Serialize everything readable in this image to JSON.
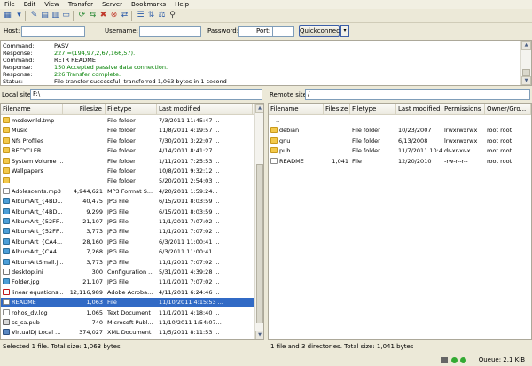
{
  "menu": [
    "File",
    "Edit",
    "View",
    "Transfer",
    "Server",
    "Bookmarks",
    "Help"
  ],
  "quickconnect": {
    "host_label": "Host:",
    "host_value": "",
    "username_label": "Username:",
    "username_value": "",
    "password_label": "Password:",
    "password_value": "",
    "port_label": "Port:",
    "port_value": "",
    "button_label": "Quickconnect",
    "dropdown_glyph": "▾"
  },
  "log": [
    {
      "key": "Command:",
      "text": "PASV",
      "color": "#000000"
    },
    {
      "key": "Response:",
      "text": "227 =(194,97,2,67,166,57).",
      "color": "#008000"
    },
    {
      "key": "Command:",
      "text": "RETR README",
      "color": "#000000"
    },
    {
      "key": "Response:",
      "text": "150 Accepted passive data connection.",
      "color": "#008000"
    },
    {
      "key": "Response:",
      "text": "226 Transfer complete.",
      "color": "#008000"
    },
    {
      "key": "Status:",
      "text": "File transfer successful, transferred 1,063 bytes in 1 second",
      "color": "#000000"
    }
  ],
  "local": {
    "site_label": "Local site:",
    "site_value": "F:\\",
    "columns": [
      "Filename",
      "Filesize",
      "Filetype",
      "Last modified"
    ],
    "rows": [
      {
        "icon": "folder",
        "name": "msdownld.tmp",
        "size": "",
        "type": "File folder",
        "modified": "7/3/2011 11:45:47 ..."
      },
      {
        "icon": "folder",
        "name": "Music",
        "size": "",
        "type": "File folder",
        "modified": "11/8/2011 4:19:57 ..."
      },
      {
        "icon": "folder",
        "name": "Nfs Profiles",
        "size": "",
        "type": "File folder",
        "modified": "7/30/2011 3:22:07 ..."
      },
      {
        "icon": "folder",
        "name": "RECYCLER",
        "size": "",
        "type": "File folder",
        "modified": "4/14/2011 8:41:27 ..."
      },
      {
        "icon": "folder",
        "name": "System Volume ...",
        "size": "",
        "type": "File folder",
        "modified": "1/11/2011 7:25:53 ..."
      },
      {
        "icon": "folder",
        "name": "Wallpapers",
        "size": "",
        "type": "File folder",
        "modified": "10/8/2011 9:32:12 ..."
      },
      {
        "icon": "folder",
        "name": "",
        "size": "",
        "type": "File folder",
        "modified": "5/20/2011 2:54:03 ..."
      },
      {
        "icon": "file",
        "name": "Adolescents.mp3",
        "size": "4,944,621",
        "type": "MP3 Format S...",
        "modified": "4/20/2011 1:59:24..."
      },
      {
        "icon": "img",
        "name": "AlbumArt_{4BD...",
        "size": "40,475",
        "type": "JPG File",
        "modified": "6/15/2011 8:03:59 ..."
      },
      {
        "icon": "img",
        "name": "AlbumArt_{4BD...",
        "size": "9,299",
        "type": "JPG File",
        "modified": "6/15/2011 8:03:59 ..."
      },
      {
        "icon": "img",
        "name": "AlbumArt_{52FF...",
        "size": "21,107",
        "type": "JPG File",
        "modified": "11/1/2011 7:07:02 ..."
      },
      {
        "icon": "img",
        "name": "AlbumArt_{52FF...",
        "size": "3,773",
        "type": "JPG File",
        "modified": "11/1/2011 7:07:02 ..."
      },
      {
        "icon": "img",
        "name": "AlbumArt_{CA4...",
        "size": "28,160",
        "type": "JPG File",
        "modified": "6/3/2011 11:00:41 ..."
      },
      {
        "icon": "img",
        "name": "AlbumArt_{CA4...",
        "size": "7,268",
        "type": "JPG File",
        "modified": "6/3/2011 11:00:41 ..."
      },
      {
        "icon": "img",
        "name": "AlbumArtSmall.j...",
        "size": "3,773",
        "type": "JPG File",
        "modified": "11/1/2011 7:07:02 ..."
      },
      {
        "icon": "ini",
        "name": "desktop.ini",
        "size": "300",
        "type": "Configuration ...",
        "modified": "5/31/2011 4:39:28 ..."
      },
      {
        "icon": "img",
        "name": "Folder.jpg",
        "size": "21,107",
        "type": "JPG File",
        "modified": "11/1/2011 7:07:02 ..."
      },
      {
        "icon": "pdf",
        "name": "linear equations ...",
        "size": "12,116,989",
        "type": "Adobe Acroba...",
        "modified": "4/11/2011 6:24:46 ..."
      },
      {
        "icon": "file",
        "name": "README",
        "size": "1,063",
        "type": "File",
        "modified": "11/10/2011 4:15:53 ...",
        "selected": true
      },
      {
        "icon": "file",
        "name": "rohos_dv.log",
        "size": "1,065",
        "type": "Text Document",
        "modified": "11/1/2011 4:18:40 ..."
      },
      {
        "icon": "exe",
        "name": "ss_sa.pub",
        "size": "740",
        "type": "Microsoft Publ...",
        "modified": "11/10/2011 1:54:07..."
      },
      {
        "icon": "xml",
        "name": "VirtualDJ Local ...",
        "size": "374,027",
        "type": "XML Document",
        "modified": "11/5/2011 8:11:53 ..."
      }
    ],
    "status": "Selected 1 file. Total size: 1,063 bytes"
  },
  "remote": {
    "site_label": "Remote site:",
    "site_value": "/",
    "columns": [
      "Filename",
      "Filesize",
      "Filetype",
      "Last modified",
      "Permissions",
      "Owner/Gro..."
    ],
    "rows": [
      {
        "icon": "up",
        "name": "..",
        "size": "",
        "type": "",
        "modified": "",
        "perms": "",
        "owner": ""
      },
      {
        "icon": "folder",
        "name": "debian",
        "size": "",
        "type": "File folder",
        "modified": "10/23/2007",
        "perms": "lrwxrwxrwx",
        "owner": "root root"
      },
      {
        "icon": "folder",
        "name": "gnu",
        "size": "",
        "type": "File folder",
        "modified": "6/13/2008",
        "perms": "lrwxrwxrwx",
        "owner": "root root"
      },
      {
        "icon": "folder",
        "name": "pub",
        "size": "",
        "type": "File folder",
        "modified": "11/7/2011 10:4...",
        "perms": "dr-xr-xr-x",
        "owner": "root root"
      },
      {
        "icon": "file",
        "name": "README",
        "size": "1,041",
        "type": "File",
        "modified": "12/20/2010",
        "perms": "-rw-r--r--",
        "owner": "root root"
      }
    ],
    "status": "1 file and 3 directories. Total size: 1,041 bytes"
  },
  "queue_label": "Queue: 2.1 KiB"
}
